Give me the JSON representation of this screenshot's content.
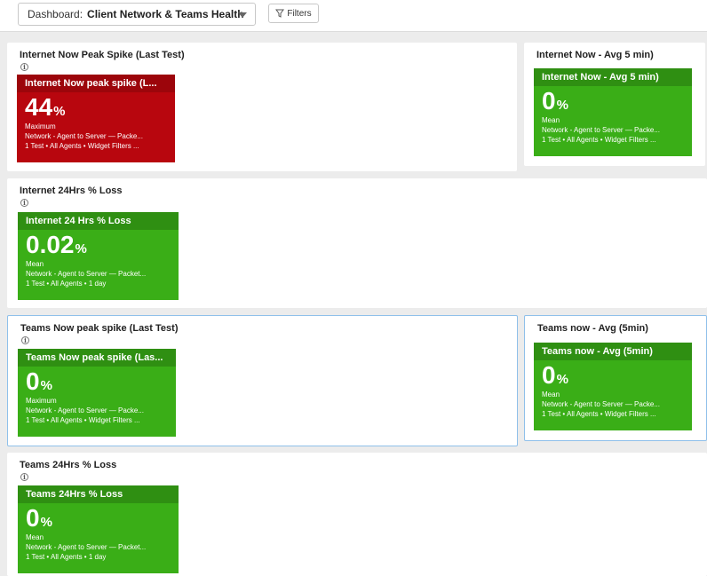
{
  "toolbar": {
    "dashboard_prefix": "Dashboard:",
    "dashboard_name": "Client Network & Teams Health",
    "filters_label": "Filters"
  },
  "colors": {
    "green": "#3aae17",
    "red": "#b8060e",
    "selected_border": "#8fc0ea"
  },
  "widgets": [
    {
      "title": "Internet Now Peak Spike (Last Test)",
      "has_info": true,
      "tile": {
        "color": "red",
        "header": "Internet Now peak spike (L...",
        "value": "44",
        "unit": "%",
        "stat": "Maximum",
        "source": "Network - Agent to Server — Packe...",
        "scope": "1 Test • All Agents • Widget Filters ..."
      }
    },
    {
      "title": "Internet Now - Avg 5 min)",
      "has_info": false,
      "tile": {
        "color": "green",
        "header": "Internet Now - Avg 5 min)",
        "value": "0",
        "unit": "%",
        "stat": "Mean",
        "source": "Network - Agent to Server — Packe...",
        "scope": "1 Test • All Agents • Widget Filters ..."
      }
    },
    {
      "title": "Internet 24Hrs % Loss",
      "has_info": true,
      "tile": {
        "color": "green",
        "header": "Internet 24 Hrs % Loss",
        "value": "0.02",
        "unit": "%",
        "stat": "Mean",
        "source": "Network - Agent to Server — Packet...",
        "scope": "1 Test • All Agents • 1 day"
      }
    },
    {
      "title": "Teams Now peak spike (Last Test)",
      "has_info": true,
      "tile": {
        "color": "green",
        "header": "Teams Now peak spike (Las...",
        "value": "0",
        "unit": "%",
        "stat": "Maximum",
        "source": "Network - Agent to Server — Packe...",
        "scope": "1 Test • All Agents • Widget Filters ..."
      }
    },
    {
      "title": "Teams now - Avg (5min)",
      "has_info": false,
      "tile": {
        "color": "green",
        "header": "Teams now - Avg (5min)",
        "value": "0",
        "unit": "%",
        "stat": "Mean",
        "source": "Network - Agent to Server — Packe...",
        "scope": "1 Test • All Agents • Widget Filters ..."
      }
    },
    {
      "title": "Teams 24Hrs % Loss",
      "has_info": true,
      "tile": {
        "color": "green",
        "header": "Teams 24Hrs % Loss",
        "value": "0",
        "unit": "%",
        "stat": "Mean",
        "source": "Network - Agent to Server — Packet...",
        "scope": "1 Test • All Agents • 1 day"
      }
    }
  ]
}
